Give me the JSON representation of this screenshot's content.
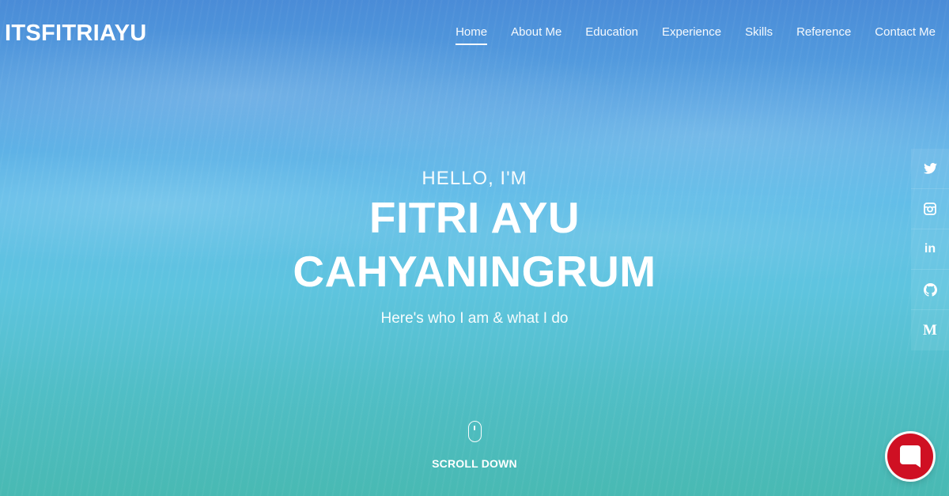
{
  "brand": "ITSFITRIAYU",
  "nav": {
    "items": [
      {
        "label": "Home",
        "active": true
      },
      {
        "label": "About Me",
        "active": false
      },
      {
        "label": "Education",
        "active": false
      },
      {
        "label": "Experience",
        "active": false
      },
      {
        "label": "Skills",
        "active": false
      },
      {
        "label": "Reference",
        "active": false
      },
      {
        "label": "Contact Me",
        "active": false
      }
    ]
  },
  "hero": {
    "greeting": "HELLO, I'M",
    "name_line1": "FITRI AYU",
    "name_line2": "CAHYANINGRUM",
    "tagline": "Here's who I am & what I do"
  },
  "scroll": {
    "label": "SCROLL DOWN",
    "icon": "mouse-icon"
  },
  "social": {
    "items": [
      {
        "icon": "twitter-icon"
      },
      {
        "icon": "instagram-icon"
      },
      {
        "icon": "linkedin-icon",
        "glyph": "in"
      },
      {
        "icon": "github-icon"
      },
      {
        "icon": "medium-icon",
        "glyph": "M"
      }
    ]
  },
  "chat": {
    "icon": "chat-icon",
    "color": "#cf1023"
  }
}
